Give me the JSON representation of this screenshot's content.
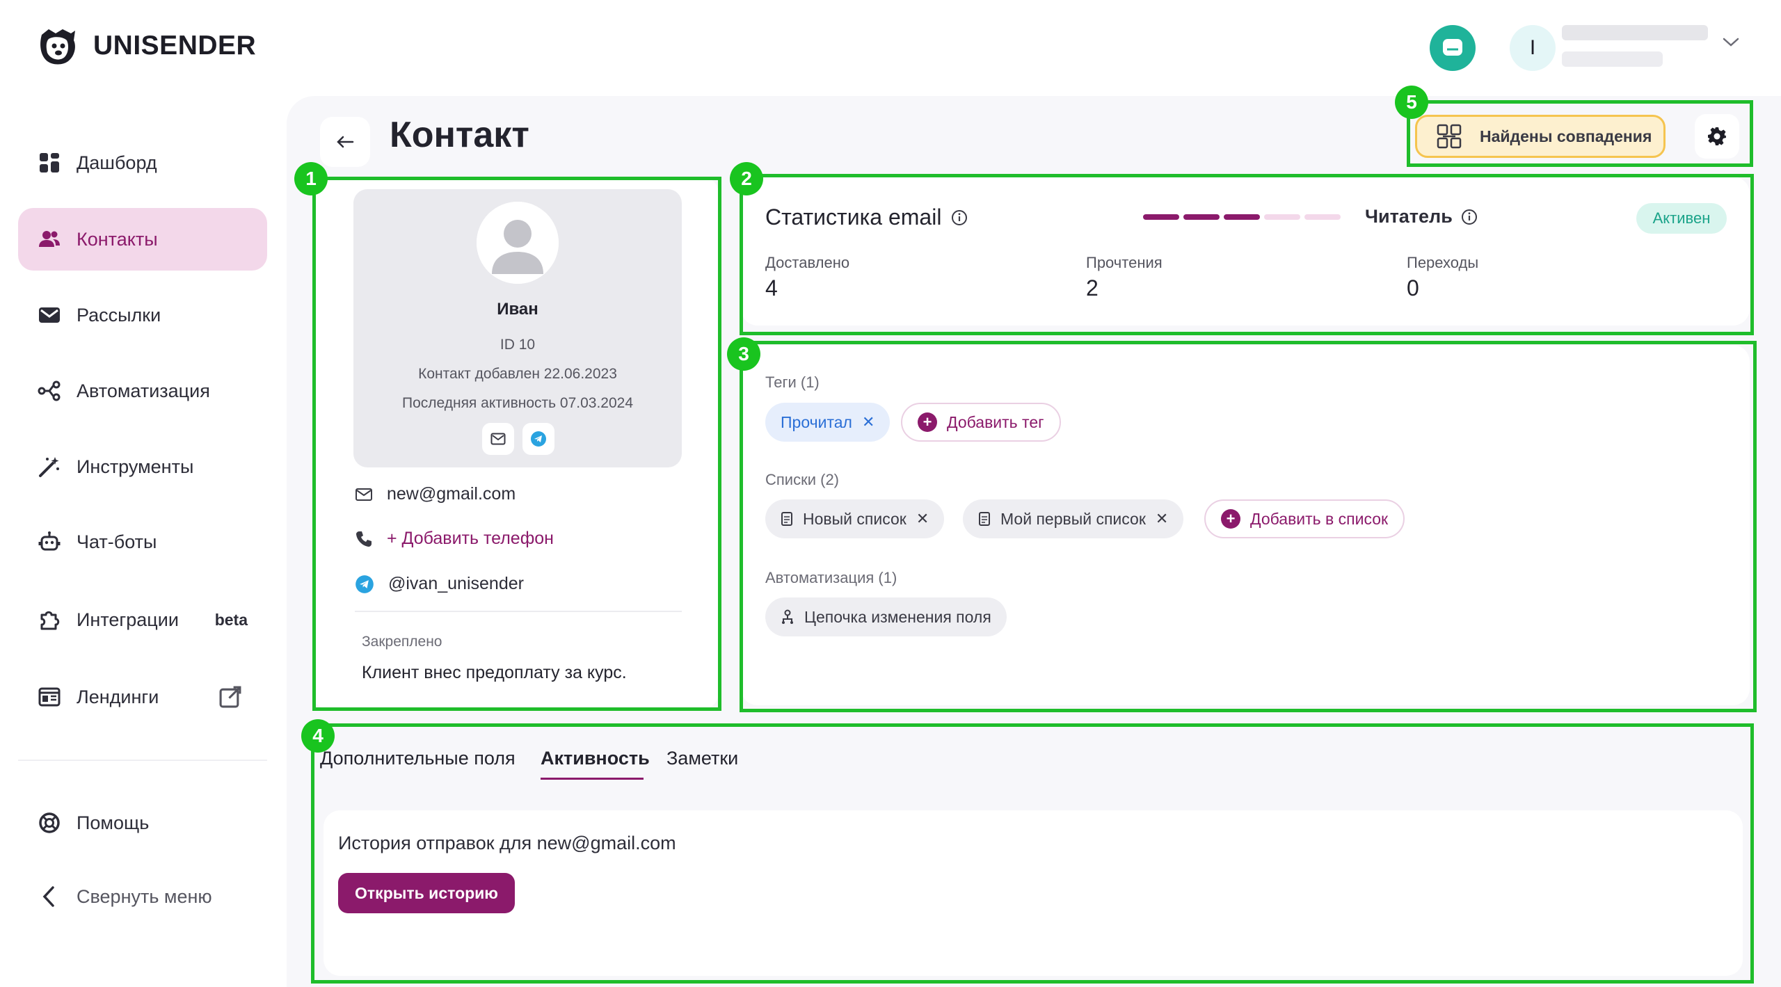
{
  "app": {
    "brand": "UNISENDER"
  },
  "sidebar": {
    "items": [
      {
        "label": "Дашборд",
        "icon": "dashboard-icon"
      },
      {
        "label": "Контакты",
        "icon": "contacts-icon",
        "active": true
      },
      {
        "label": "Рассылки",
        "icon": "mail-icon"
      },
      {
        "label": "Автоматизация",
        "icon": "automation-icon"
      },
      {
        "label": "Инструменты",
        "icon": "magic-wand-icon"
      },
      {
        "label": "Чат-боты",
        "icon": "robot-icon"
      },
      {
        "label": "Интеграции",
        "icon": "puzzle-icon",
        "badge": "beta"
      },
      {
        "label": "Лендинги",
        "icon": "landing-icon",
        "external": true
      }
    ],
    "help": "Помощь",
    "collapse": "Свернуть меню"
  },
  "header": {
    "user_initial": "I"
  },
  "page": {
    "title": "Контакт",
    "matches_button": "Найдены совпадения"
  },
  "markers": [
    "1",
    "2",
    "3",
    "4",
    "5"
  ],
  "profile": {
    "name": "Иван",
    "id": "ID 10",
    "added": "Контакт добавлен 22.06.2023",
    "last_activity": "Последняя активность 07.03.2024",
    "email": "new@gmail.com",
    "add_phone": "+ Добавить телефон",
    "telegram": "@ivan_unisender",
    "pinned_label": "Закреплено",
    "pinned_text": "Клиент внес предоплату за курс."
  },
  "stats": {
    "title": "Статистика email",
    "segments_filled": 3,
    "segments_total": 5,
    "reader_label": "Читатель",
    "status": "Активен",
    "metrics": [
      {
        "label": "Доставлено",
        "value": "4"
      },
      {
        "label": "Прочтения",
        "value": "2"
      },
      {
        "label": "Переходы",
        "value": "0"
      }
    ]
  },
  "tags": {
    "label": "Теги (1)",
    "items": [
      "Прочитал"
    ],
    "add": "Добавить тег"
  },
  "lists": {
    "label": "Списки (2)",
    "items": [
      "Новый список",
      "Мой первый список"
    ],
    "add": "Добавить в список"
  },
  "automation": {
    "label": "Автоматизация (1)",
    "items": [
      "Цепочка изменения поля"
    ]
  },
  "tabs": {
    "items": [
      "Дополнительные поля",
      "Активность",
      "Заметки"
    ],
    "active": "Активность"
  },
  "activity": {
    "history_text": "История отправок для new@gmail.com",
    "open_history": "Открыть историю"
  },
  "colors": {
    "accent": "#8b1a6b",
    "active_nav_bg": "#f3d8ea",
    "annotation_green": "#1fbd2b",
    "status_green": "#1aa389",
    "tag_blue": "#2b6fd6"
  }
}
